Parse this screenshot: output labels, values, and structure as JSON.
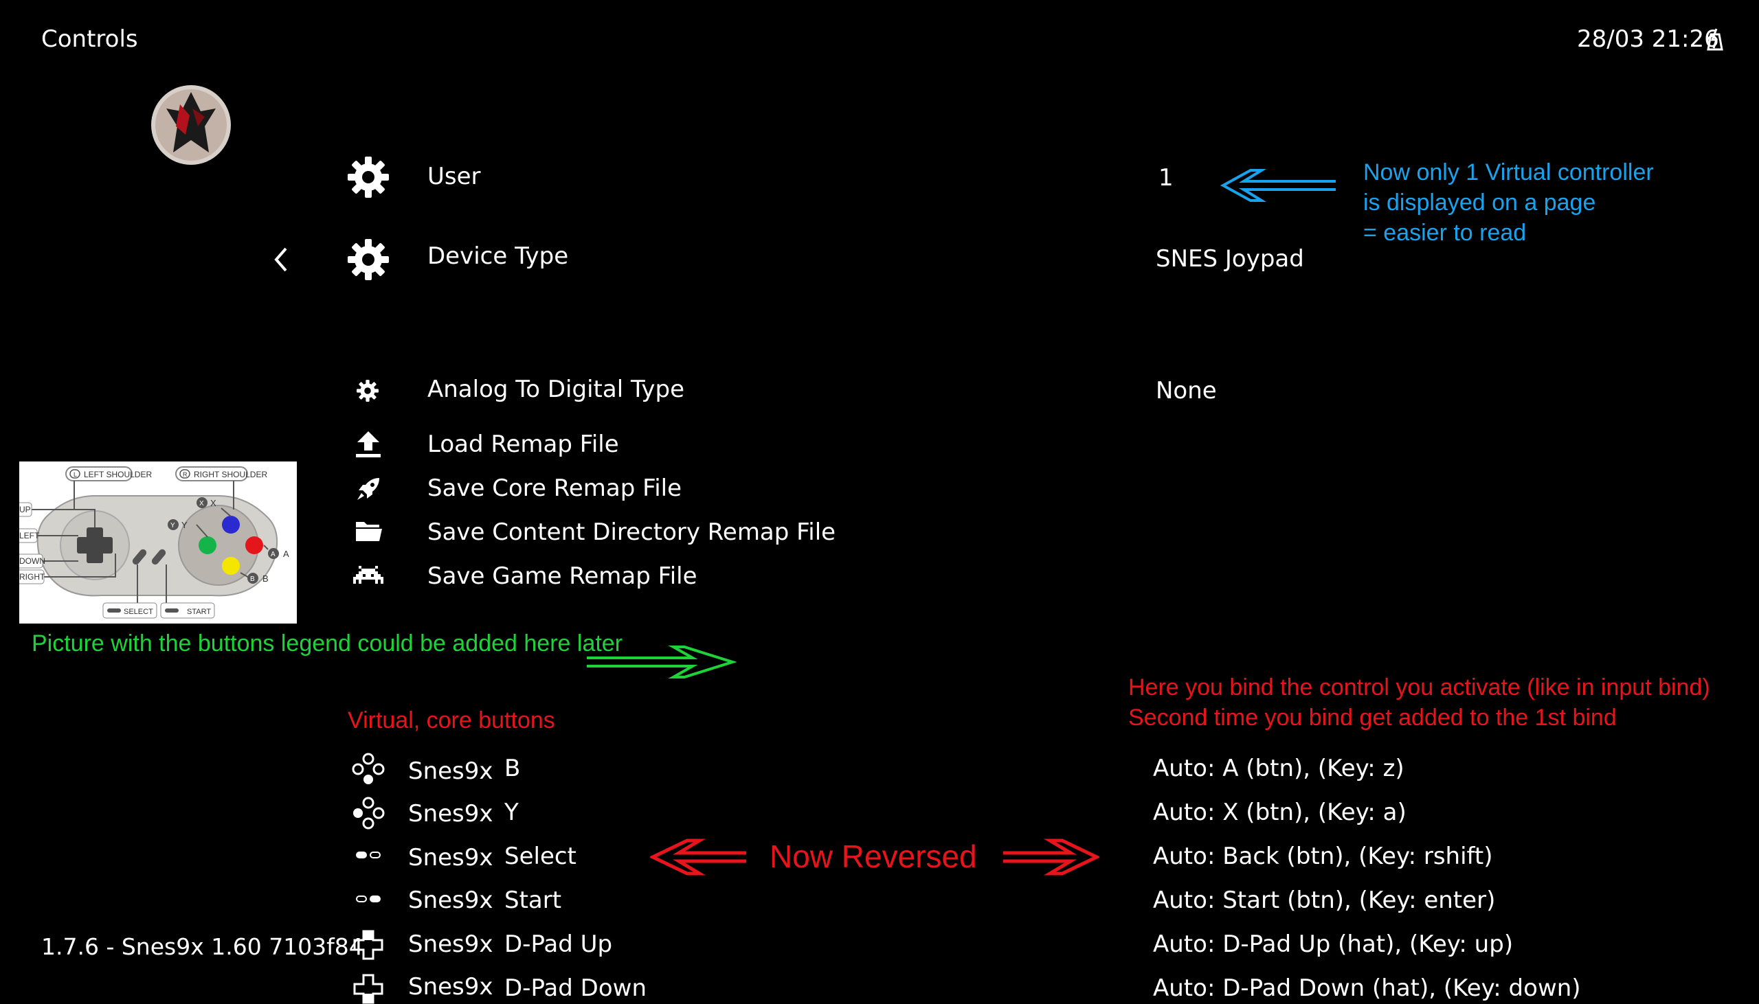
{
  "header": {
    "title": "Controls",
    "datetime": "28/03 21:26"
  },
  "footer": {
    "version": "1.7.6 - Snes9x 1.60 7103f84"
  },
  "settings": [
    {
      "label": "User",
      "value": "1",
      "icon": "gear-icon"
    },
    {
      "label": "Device Type",
      "value": "SNES Joypad",
      "icon": "gear-icon"
    },
    {
      "label": "Analog To Digital Type",
      "value": "None",
      "icon": "small-gear-icon"
    },
    {
      "label": "Load Remap File",
      "value": "",
      "icon": "upload-icon"
    },
    {
      "label": "Save Core Remap File",
      "value": "",
      "icon": "rocket-icon"
    },
    {
      "label": "Save Content Directory Remap File",
      "value": "",
      "icon": "folder-icon"
    },
    {
      "label": "Save Game Remap File",
      "value": "",
      "icon": "invader-icon"
    }
  ],
  "core_binds": [
    {
      "core": "Snes9x",
      "button": "B",
      "bind": "Auto: A (btn), (Key: z)",
      "icon": "gamepad-face-buttons-icon"
    },
    {
      "core": "Snes9x",
      "button": "Y",
      "bind": "Auto: X (btn), (Key: a)",
      "icon": "gamepad-face-buttons-icon"
    },
    {
      "core": "Snes9x",
      "button": "Select",
      "bind": "Auto: Back (btn), (Key: rshift)",
      "icon": "select-button-icon"
    },
    {
      "core": "Snes9x",
      "button": "Start",
      "bind": "Auto: Start (btn), (Key: enter)",
      "icon": "start-button-icon"
    },
    {
      "core": "Snes9x",
      "button": "D-Pad Up",
      "bind": "Auto:  D-Pad Up (hat), (Key: up)",
      "icon": "dpad-icon"
    },
    {
      "core": "Snes9x",
      "button": "D-Pad Down",
      "bind": "Auto:  D-Pad Down (hat), (Key: down)",
      "icon": "dpad-icon"
    }
  ],
  "controller_legend": {
    "left_shoulder": "LEFT SHOULDER",
    "left_shoulder_key": "L",
    "right_shoulder": "RIGHT SHOULDER",
    "right_shoulder_key": "R",
    "up": "UP",
    "left": "LEFT",
    "down": "DOWN",
    "right": "RIGHT",
    "select": "SELECT",
    "start": "START",
    "x": "X",
    "y": "Y",
    "a": "A",
    "b": "B"
  },
  "annotations": {
    "blue_lines": [
      "Now only 1 Virtual controller",
      "is displayed on a page",
      "= easier to read"
    ],
    "green": "Picture with the buttons legend could be added here later",
    "red_top_lines": [
      "Here you bind the control you activate (like in input bind)",
      "Second time you bind get added to the 1st bind"
    ],
    "red_left": "Virtual, core buttons",
    "red_center": "Now Reversed"
  },
  "colors": {
    "blue": "#1aa3ec",
    "green": "#1ed33a",
    "red": "#e8141c",
    "pad_red": "#e4151b",
    "pad_yellow": "#f5e600",
    "pad_green": "#15b44a",
    "pad_blue": "#2a2ad0"
  }
}
